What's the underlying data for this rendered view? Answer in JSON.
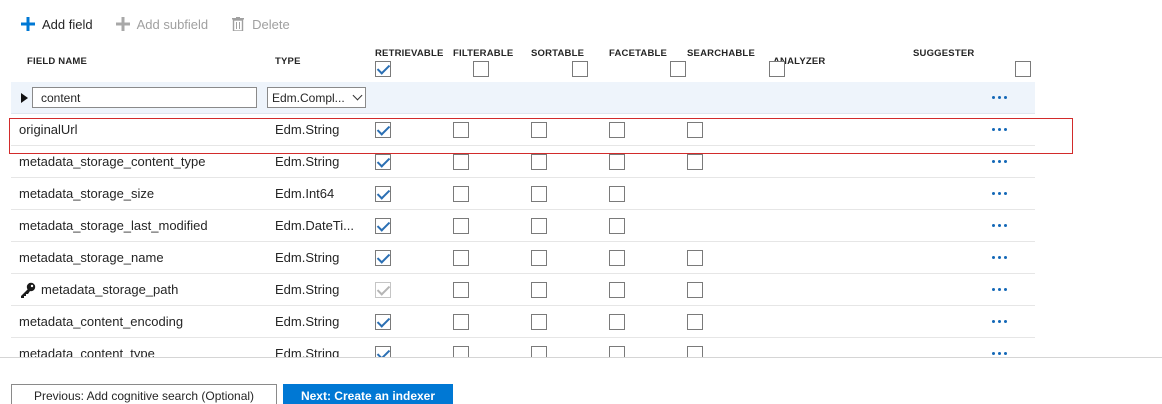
{
  "toolbar": {
    "add_field": "Add field",
    "add_subfield": "Add subfield",
    "delete": "Delete"
  },
  "columns": {
    "field_name": "FIELD NAME",
    "type": "TYPE",
    "retrievable": "RETRIEVABLE",
    "filterable": "FILTERABLE",
    "sortable": "SORTABLE",
    "facetable": "FACETABLE",
    "searchable": "SEARCHABLE",
    "analyzer": "ANALYZER",
    "suggester": "SUGGESTER"
  },
  "header_checks": {
    "retrievable": true,
    "filterable": false,
    "sortable": false,
    "facetable": false,
    "searchable": false,
    "suggester": false
  },
  "complex_row": {
    "name_value": "content",
    "type_value": "Edm.Compl..."
  },
  "rows": [
    {
      "name": "originalUrl",
      "type": "Edm.String",
      "retrievable": true,
      "filterable": false,
      "sortable": false,
      "facetable": false,
      "searchable": false,
      "has_searchable": true,
      "key": false,
      "highlighted": true
    },
    {
      "name": "metadata_storage_content_type",
      "type": "Edm.String",
      "retrievable": true,
      "filterable": false,
      "sortable": false,
      "facetable": false,
      "searchable": false,
      "has_searchable": true,
      "key": false
    },
    {
      "name": "metadata_storage_size",
      "type": "Edm.Int64",
      "retrievable": true,
      "filterable": false,
      "sortable": false,
      "facetable": false,
      "searchable": false,
      "has_searchable": false,
      "key": false
    },
    {
      "name": "metadata_storage_last_modified",
      "type": "Edm.DateTi...",
      "retrievable": true,
      "filterable": false,
      "sortable": false,
      "facetable": false,
      "searchable": false,
      "has_searchable": false,
      "key": false
    },
    {
      "name": "metadata_storage_name",
      "type": "Edm.String",
      "retrievable": true,
      "filterable": false,
      "sortable": false,
      "facetable": false,
      "searchable": false,
      "has_searchable": true,
      "key": false
    },
    {
      "name": "metadata_storage_path",
      "type": "Edm.String",
      "retrievable": true,
      "filterable": false,
      "sortable": false,
      "facetable": false,
      "searchable": false,
      "has_searchable": true,
      "key": true
    },
    {
      "name": "metadata_content_encoding",
      "type": "Edm.String",
      "retrievable": true,
      "filterable": false,
      "sortable": false,
      "facetable": false,
      "searchable": false,
      "has_searchable": true,
      "key": false
    },
    {
      "name": "metadata_content_type",
      "type": "Edm.String",
      "retrievable": true,
      "filterable": false,
      "sortable": false,
      "facetable": false,
      "searchable": false,
      "has_searchable": true,
      "key": false
    }
  ],
  "footer": {
    "previous": "Previous: Add cognitive search (Optional)",
    "next": "Next: Create an indexer"
  },
  "colors": {
    "accent": "#0078d4",
    "check": "#2b6fb3",
    "highlight_border": "#d22b2b",
    "ellipsis": "#1468b7"
  },
  "icons": {
    "add": "plus-icon",
    "delete": "trash-icon",
    "key": "key-icon",
    "more": "more-icon",
    "expand": "expand-icon",
    "dropdown": "chevron-down-icon"
  }
}
